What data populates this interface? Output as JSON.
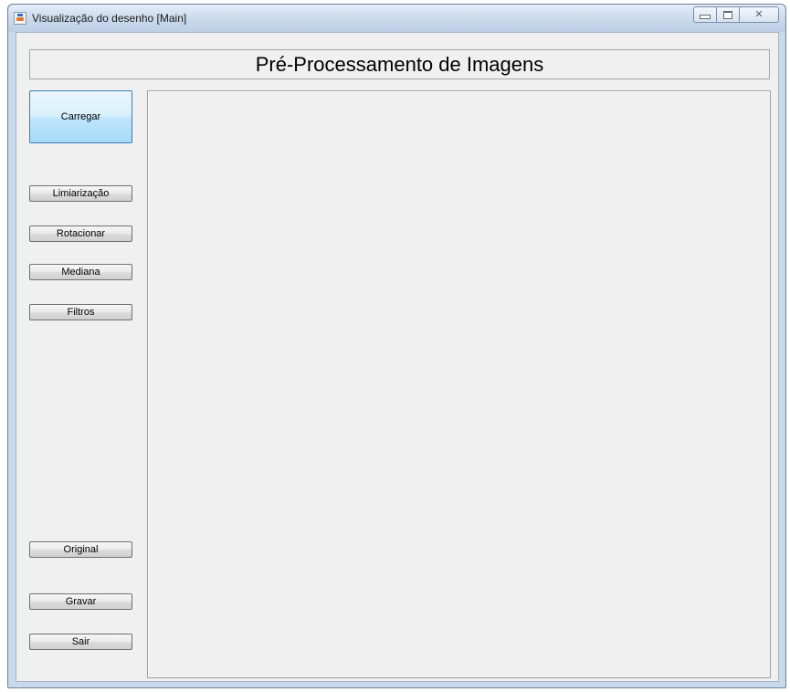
{
  "window": {
    "title": "Visualização do desenho [Main]",
    "controls": {
      "minimize": "minimize",
      "maximize": "maximize",
      "close": "✕"
    }
  },
  "header": {
    "title": "Pré-Processamento de Imagens"
  },
  "sidebar": {
    "load_label": "Carregar",
    "threshold_label": "Limiarização",
    "rotate_label": "Rotacionar",
    "median_label": "Mediana",
    "filters_label": "Filtros",
    "original_label": "Original",
    "save_label": "Gravar",
    "exit_label": "Sair"
  },
  "colors": {
    "accent_button": "#bee6fd",
    "titlebar": "#cddcee",
    "panel_background": "#f0f0f0"
  }
}
